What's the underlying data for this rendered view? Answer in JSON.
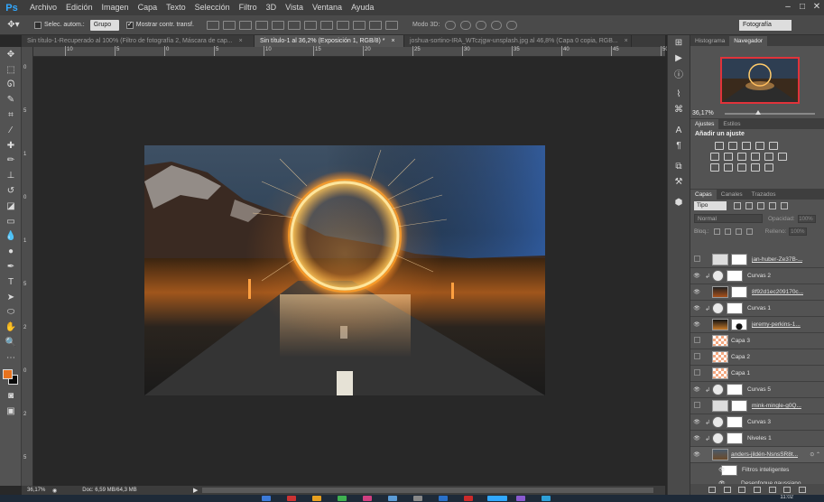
{
  "app": {
    "logo": "Ps",
    "menu": [
      "Archivo",
      "Edición",
      "Imagen",
      "Capa",
      "Texto",
      "Selección",
      "Filtro",
      "3D",
      "Vista",
      "Ventana",
      "Ayuda"
    ],
    "window_controls": [
      "–",
      "□",
      "✕"
    ]
  },
  "options": {
    "auto_select_label": "Selec. autom.:",
    "auto_select_value": "Grupo",
    "show_transform_label": "Mostrar contr. transf.",
    "mode3d_label": "Modo 3D:",
    "workspace": "Fotografía"
  },
  "tabs": [
    {
      "label": "Sin título-1-Recuperado al 100% (Filtro de fotografía 2, Máscara de cap...",
      "active": false
    },
    {
      "label": "Sin título-1 al 36,2% (Exposición 1, RGB/8) *",
      "active": true
    },
    {
      "label": "joshua-sortino-IRA_WTczjgw-unsplash.jpg al 46,8% (Capa 0 copia, RGB...",
      "active": false
    }
  ],
  "ruler": {
    "h_labels": [
      "10",
      "5",
      "0",
      "5",
      "10",
      "15",
      "20",
      "25",
      "30",
      "35",
      "40",
      "45",
      "50",
      "55"
    ],
    "v_labels": [
      "0",
      "5",
      "1",
      "0",
      "1",
      "5",
      "2",
      "0",
      "2",
      "5"
    ]
  },
  "status": {
    "zoom": "36,17%",
    "doc": "Doc: 6,59 MB/64,3 MB",
    "arrow": "▶"
  },
  "navigator": {
    "tabs": [
      "Histograma",
      "Navegador"
    ],
    "zoom": "36,17%"
  },
  "adjustments": {
    "tabs": [
      "Ajustes",
      "Estilos"
    ],
    "title": "Añadir un ajuste"
  },
  "layers_panel": {
    "tabs": [
      "Capas",
      "Canales",
      "Trazados"
    ],
    "filter": "Tipo",
    "blend": "Normal",
    "opacity_label": "Opacidad:",
    "opacity_value": "100%",
    "lock_label": "Bloq.:",
    "fill_label": "Relleno:",
    "fill_value": "100%",
    "layers": [
      {
        "name": "jan-huber-Ze37B-...",
        "visible": false,
        "clip": false,
        "kind": "photo-mask"
      },
      {
        "name": "Curvas 2",
        "visible": true,
        "clip": true,
        "kind": "adjust"
      },
      {
        "name": "8f92d1ec209170c...",
        "visible": true,
        "clip": false,
        "kind": "photo-mask"
      },
      {
        "name": "Curvas 1",
        "visible": true,
        "clip": true,
        "kind": "adjust"
      },
      {
        "name": "jeremy-perkins-1...",
        "visible": true,
        "clip": false,
        "kind": "photo-mask"
      },
      {
        "name": "Capa 3",
        "visible": false,
        "clip": false,
        "kind": "pixel"
      },
      {
        "name": "Capa 2",
        "visible": false,
        "clip": false,
        "kind": "pixel"
      },
      {
        "name": "Capa 1",
        "visible": false,
        "clip": false,
        "kind": "pixel"
      },
      {
        "name": "Curvas 5",
        "visible": true,
        "clip": true,
        "kind": "adjust"
      },
      {
        "name": "mink-mingle-g0Q...",
        "visible": false,
        "clip": false,
        "kind": "photo-mask"
      },
      {
        "name": "Curvas 3",
        "visible": true,
        "clip": true,
        "kind": "adjust"
      },
      {
        "name": "Niveles 1",
        "visible": true,
        "clip": true,
        "kind": "adjust"
      },
      {
        "name": "anders-jildén-NsnsSR8t...",
        "visible": true,
        "clip": false,
        "kind": "smart",
        "fx": "⊙ ⌃"
      }
    ],
    "smart_filters": [
      "Filtros inteligentes",
      "Desenfoque gaussiano"
    ]
  },
  "taskbar": {
    "clock": "11:02"
  },
  "colors": {
    "foreground": "#e8731e",
    "background": "#0a0a0a",
    "ps_blue": "#31a8ff"
  }
}
